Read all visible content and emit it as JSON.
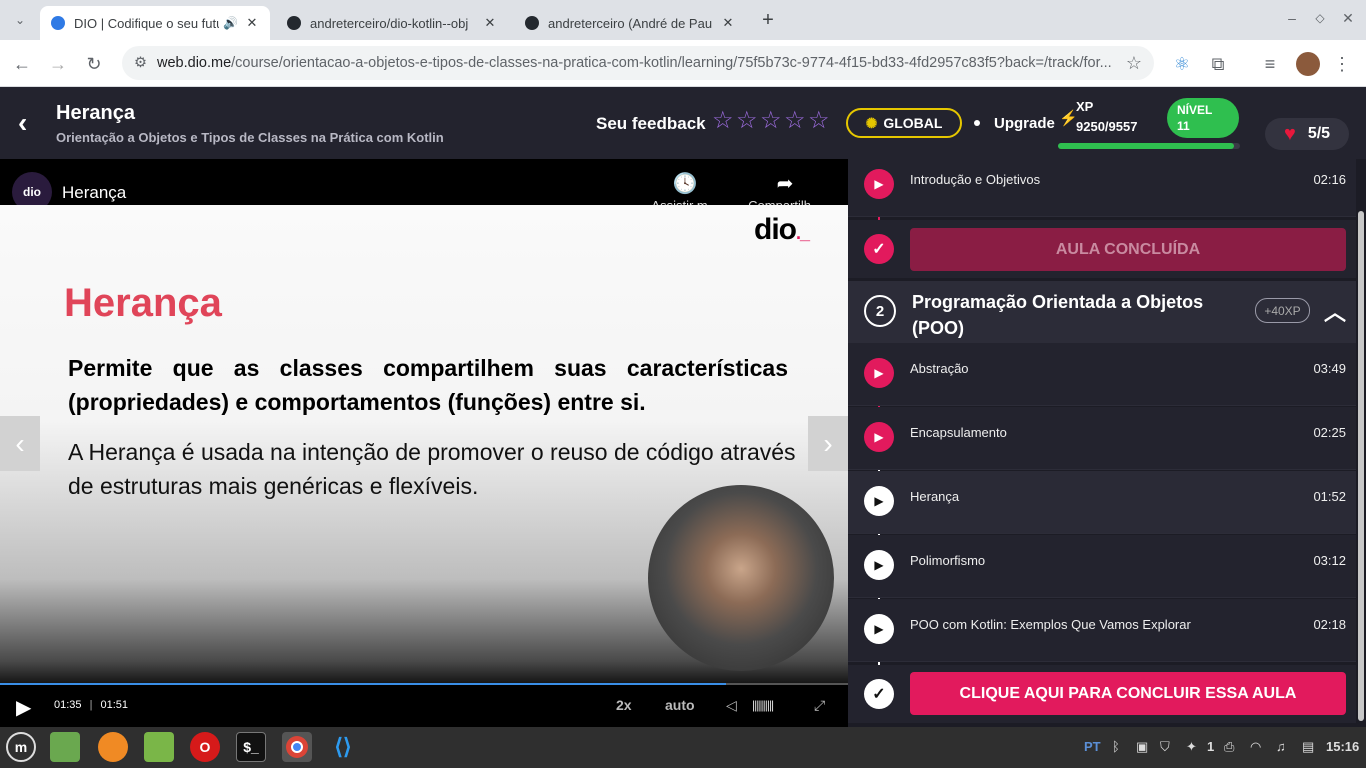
{
  "browser": {
    "tabs": [
      {
        "title": "DIO | Codifique o seu futuro",
        "active": true
      },
      {
        "title": "andreterceiro/dio-kotlin--obj"
      },
      {
        "title": "andreterceiro (André de Pau"
      }
    ],
    "new_tab": "+",
    "url_host": "web.dio.me",
    "url_path": "/course/orientacao-a-objetos-e-tipos-de-classes-na-pratica-com-kotlin/learning/75f5b73c-9774-4f15-bd33-4fd2957c83f5?back=/track/for..."
  },
  "header": {
    "title": "Herança",
    "subtitle": "Orientação a Objetos e Tipos de Classes na Prática com Kotlin",
    "feedback_label": "Seu feedback",
    "global_label": "GLOBAL",
    "upgrade_label": "Upgrade",
    "xp_label": "XP",
    "xp_value": "9250/9557",
    "xp_progress": 0.968,
    "nivel_label": "NÍVEL",
    "nivel_value": "11",
    "lives": "5/5"
  },
  "video": {
    "channel_title": "Herança",
    "watch_later": "Assistir m...",
    "share": "Compartilh...",
    "slide_title": "Herança",
    "slide_bold": "Permite que as classes compartilhem suas características (propriedades) e comportamentos (funções) entre si.",
    "slide_text": "A Herança é usada na intenção de promover o reuso de código através de estruturas mais genéricas e flexíveis.",
    "current_time": "01:35",
    "separator": "|",
    "duration": "01:51",
    "progress": 0.856,
    "speed": "2x",
    "quality": "auto"
  },
  "sidebar": {
    "top_lesson": {
      "name": "Introdução e Objetivos",
      "duration": "02:16"
    },
    "done_label": "AULA CONCLUÍDA",
    "module": {
      "number": "2",
      "title": "Programação Orientada a Objetos (POO)",
      "xp": "+40XP"
    },
    "lessons": [
      {
        "name": "Abstração",
        "duration": "03:49",
        "done": true
      },
      {
        "name": "Encapsulamento",
        "duration": "02:25",
        "done": true
      },
      {
        "name": "Herança",
        "duration": "01:52",
        "done": false
      },
      {
        "name": "Polimorfismo",
        "duration": "03:12",
        "done": false
      },
      {
        "name": "POO com Kotlin: Exemplos Que Vamos Explorar",
        "duration": "02:18",
        "done": false
      }
    ],
    "complete_button": "CLIQUE AQUI PARA CONCLUIR ESSA AULA"
  },
  "taskbar": {
    "lang": "PT",
    "workspace": "1",
    "clock": "15:16"
  }
}
